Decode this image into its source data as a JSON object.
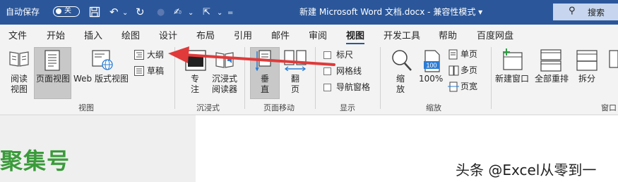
{
  "titlebar": {
    "autosave_label": "自动保存",
    "autosave_state": "关",
    "title": "新建 Microsoft Word 文档.docx  -  兼容性模式  ▾",
    "search_label": "搜索",
    "bg_color": "#2b579a"
  },
  "tabs": [
    "文件",
    "开始",
    "插入",
    "绘图",
    "设计",
    "布局",
    "引用",
    "邮件",
    "审阅",
    "视图",
    "开发工具",
    "帮助",
    "百度网盘"
  ],
  "active_tab": "视图",
  "ribbon": {
    "views": {
      "read_mode": "阅读\n视图",
      "read_mode_l1": "阅读",
      "read_mode_l2": "视图",
      "print_layout": "页面视图",
      "web_layout": "Web 版式视图",
      "outline": "大纲",
      "draft": "草稿",
      "group_label": "视图"
    },
    "immersive": {
      "focus_l1": "专",
      "focus_l2": "注",
      "reader_l1": "沉浸式",
      "reader_l2": "阅读器",
      "group_label": "沉浸式"
    },
    "page_movement": {
      "vertical_l1": "垂",
      "vertical_l2": "直",
      "side_l1": "翻",
      "side_l2": "页",
      "group_label": "页面移动"
    },
    "show": {
      "ruler": "标尺",
      "gridlines": "网格线",
      "nav_pane": "导航窗格",
      "group_label": "显示"
    },
    "zoom": {
      "zoom_l1": "缩",
      "zoom_l2": "放",
      "hundred": "100%",
      "hundred_icon": "100",
      "one_page": "单页",
      "multi_page": "多页",
      "page_width": "页宽",
      "group_label": "缩放"
    },
    "window": {
      "new_window": "新建窗口",
      "arrange_all": "全部重排",
      "split": "拆分",
      "group_label": "窗口"
    }
  },
  "document": {
    "heading": "聚集号",
    "watermark": "头条 @Excel从零到一",
    "heading_color": "#3a9b3a"
  },
  "annotation": {
    "arrow_color": "#e03a3a"
  }
}
